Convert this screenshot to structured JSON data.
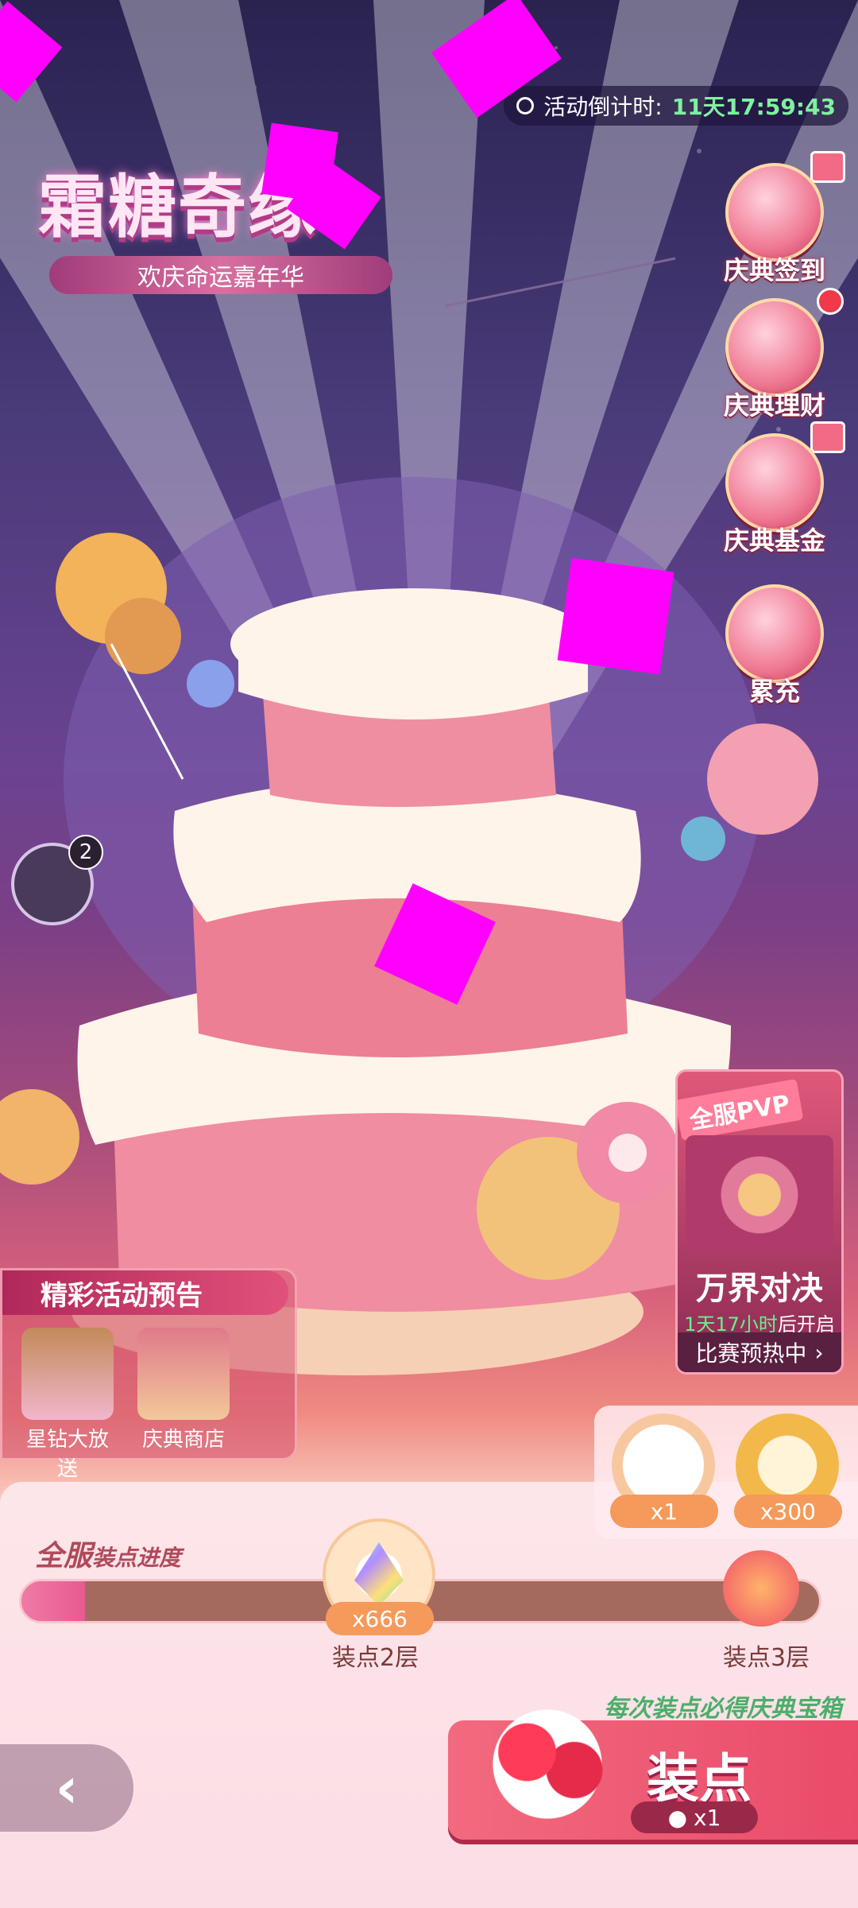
{
  "countdown": {
    "label": "活动倒计时:",
    "value": "11天17:59:43"
  },
  "event": {
    "title": "霜糖奇缘",
    "subtitle": "欢庆命运嘉年华"
  },
  "side_buttons": [
    {
      "label": "庆典签到",
      "icon": "calendar-icon"
    },
    {
      "label": "庆典理财",
      "icon": "coin-pig-icon"
    },
    {
      "label": "庆典基金",
      "icon": "fund-icon"
    },
    {
      "label": "累充",
      "icon": "gift-box-icon"
    }
  ],
  "chat": {
    "count": "2"
  },
  "pvp": {
    "tag": "全服PVP",
    "title": "万界对决",
    "time_value": "1天17小时",
    "time_suffix": "后开启",
    "footer": "比赛预热中"
  },
  "preview": {
    "title": "精彩活动预告",
    "items": [
      {
        "label": "星钻大放送"
      },
      {
        "label": "庆典商店"
      }
    ]
  },
  "rewards": [
    {
      "count": "x1"
    },
    {
      "count": "x300"
    }
  ],
  "progress": {
    "title_big": "全服",
    "title_small": "装点进度",
    "fill_fraction": 0.08,
    "milestones": [
      {
        "label": "装点2层",
        "reward": "x666"
      },
      {
        "label": "装点3层"
      }
    ]
  },
  "decorate": {
    "hint": "每次装点必得庆典宝箱",
    "label": "装点",
    "cost": "x1"
  },
  "colors": {
    "accent": "#ea4b69",
    "progress_track": "#a56a5e",
    "progress_fill": "#e95a92",
    "timer_green": "#7ff0a0"
  }
}
